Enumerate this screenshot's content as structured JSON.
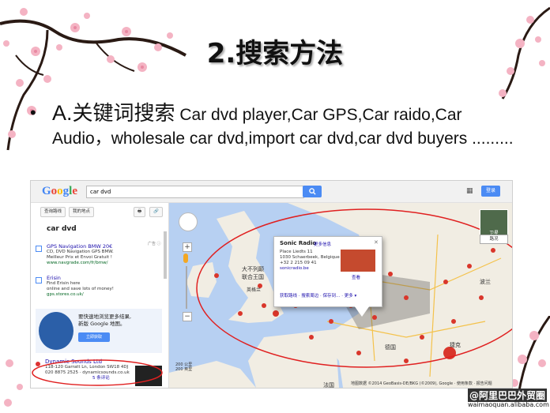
{
  "slide": {
    "title": "2.搜索方法",
    "bullet_label_a": "A.",
    "bullet_label_cn": "关键词搜索",
    "bullet_body": " Car dvd player,Car GPS,Car raido,Car Audio，wholesale car dvd,import car dvd,car dvd buyers .........",
    "bullet_symbol": "•"
  },
  "screenshot": {
    "logo": "Google",
    "search_query": "car dvd",
    "search_button_icon": "search-icon",
    "signin_label": "登录",
    "panel": {
      "tool_directions": "查询路线",
      "tool_my_places": "我的地点",
      "tool_print": "🖶",
      "tool_link": "🔗",
      "heading": "car dvd",
      "ads_label": "广告 ⓘ",
      "ads": [
        {
          "title": "GPS Navigation BMW 20€",
          "lines": [
            "CD, DVD Navigation GPS BMW.",
            "Meilleur Prix et Envoi Gratuit !"
          ],
          "url": "www.navgrade.com/fr/bmw/"
        },
        {
          "title": "Erisin",
          "lines": [
            "Find Erisin here",
            "online and save lots of money!"
          ],
          "url": "gps.stores.co.uk/"
        }
      ],
      "promo_text_1": "要快速地浏览更多结果,",
      "promo_text_2": "新版 Google 地图。",
      "promo_button": "立即获取",
      "result": {
        "title": "Dynamic Sounds Ltd",
        "lines": [
          "118-120 Garratt Ln, London SW18 4DJ",
          "020 8875 2525 · dynamicsounds.co.uk"
        ],
        "rating": "5 条评论"
      }
    },
    "map": {
      "countries": [
        "大不列颠",
        "联合王国",
        "英格兰",
        "德国",
        "波兰",
        "法国",
        "捷克"
      ],
      "satellite_label": "卫星",
      "map_type_label": "路况",
      "scale_km": "200 公里",
      "scale_mi": "200 英里",
      "attribution": "地图数据 ©2014 GeoBasis-DE/BKG (©2009), Google · 使用条款 · 报告问题",
      "highlight_color": "#e02020",
      "infowindow": {
        "title": "Sonic Radio",
        "more": "更多信息",
        "close_icon": "close-icon",
        "address": [
          "Place Liedts 11",
          "1030 Schaerbeek, Belgique",
          "+32 2 215 09 41",
          "sonicradio.be"
        ],
        "photo_label": "查看",
        "actions": "获取路线 · 搜索周边 · 保存到… · 更多 ▾"
      }
    }
  },
  "watermark": {
    "line1": "@阿里巴巴外贸圈",
    "line2": "waimaoquan.alibaba.com"
  }
}
